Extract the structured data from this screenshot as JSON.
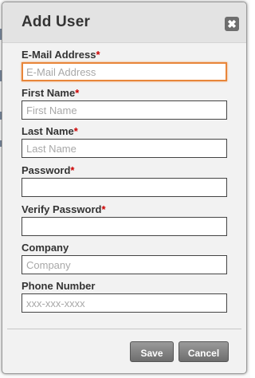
{
  "dialog": {
    "title": "Add User",
    "close_icon": "close-icon",
    "required_marker": "*",
    "accent_color": "#e8863a",
    "required_color": "#cc0000"
  },
  "fields": [
    {
      "label": "E-Mail Address",
      "required": true,
      "placeholder": "E-Mail Address",
      "value": "",
      "focused": true
    },
    {
      "label": "First Name",
      "required": true,
      "placeholder": "First Name",
      "value": ""
    },
    {
      "label": "Last Name",
      "required": true,
      "placeholder": "Last Name",
      "value": ""
    },
    {
      "label": "Password",
      "required": true,
      "placeholder": "",
      "value": ""
    },
    {
      "label": "Verify Password",
      "required": true,
      "placeholder": "",
      "value": ""
    },
    {
      "label": "Company",
      "required": false,
      "placeholder": "Company",
      "value": ""
    },
    {
      "label": "Phone Number",
      "required": false,
      "placeholder": "xxx-xxx-xxxx",
      "value": ""
    }
  ],
  "buttons": {
    "save_label": "Save",
    "cancel_label": "Cancel"
  }
}
